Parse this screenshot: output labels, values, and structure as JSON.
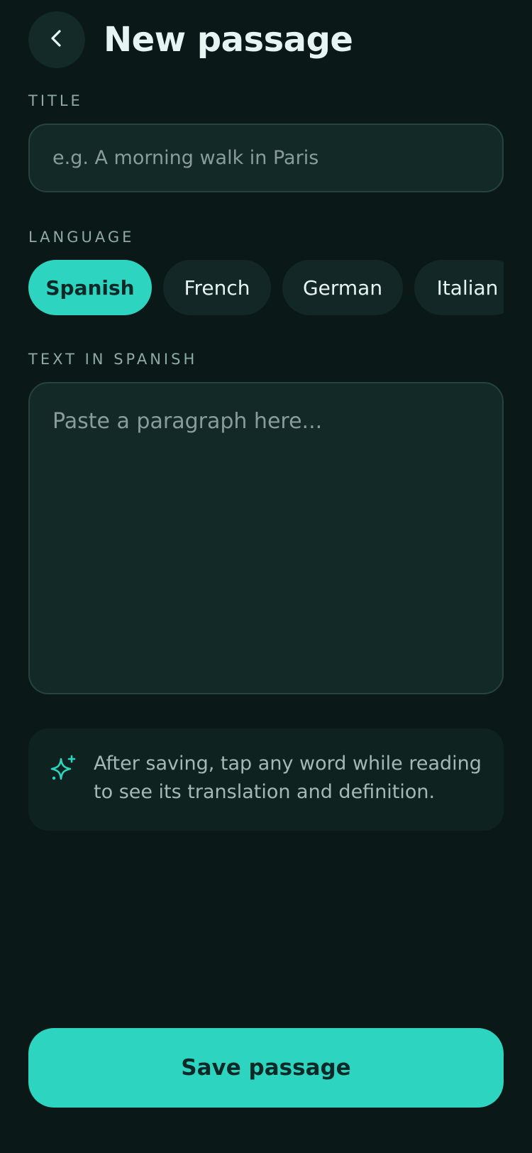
{
  "header": {
    "title": "New passage",
    "back_icon": "chevron-left-icon"
  },
  "title_field": {
    "label": "TITLE",
    "value": "",
    "placeholder": "e.g. A morning walk in Paris"
  },
  "language": {
    "label": "LANGUAGE",
    "selected": "Spanish",
    "options": [
      "Spanish",
      "French",
      "German",
      "Italian"
    ]
  },
  "text_field": {
    "label": "TEXT IN SPANISH",
    "value": "",
    "placeholder": "Paste a paragraph here..."
  },
  "tip": {
    "icon": "sparkle-icon",
    "text": "After saving, tap any word while reading to see its translation and definition."
  },
  "save_button": {
    "label": "Save passage"
  },
  "colors": {
    "background": "#0a1918",
    "accent": "#2dd4bf",
    "surface": "#132927"
  }
}
